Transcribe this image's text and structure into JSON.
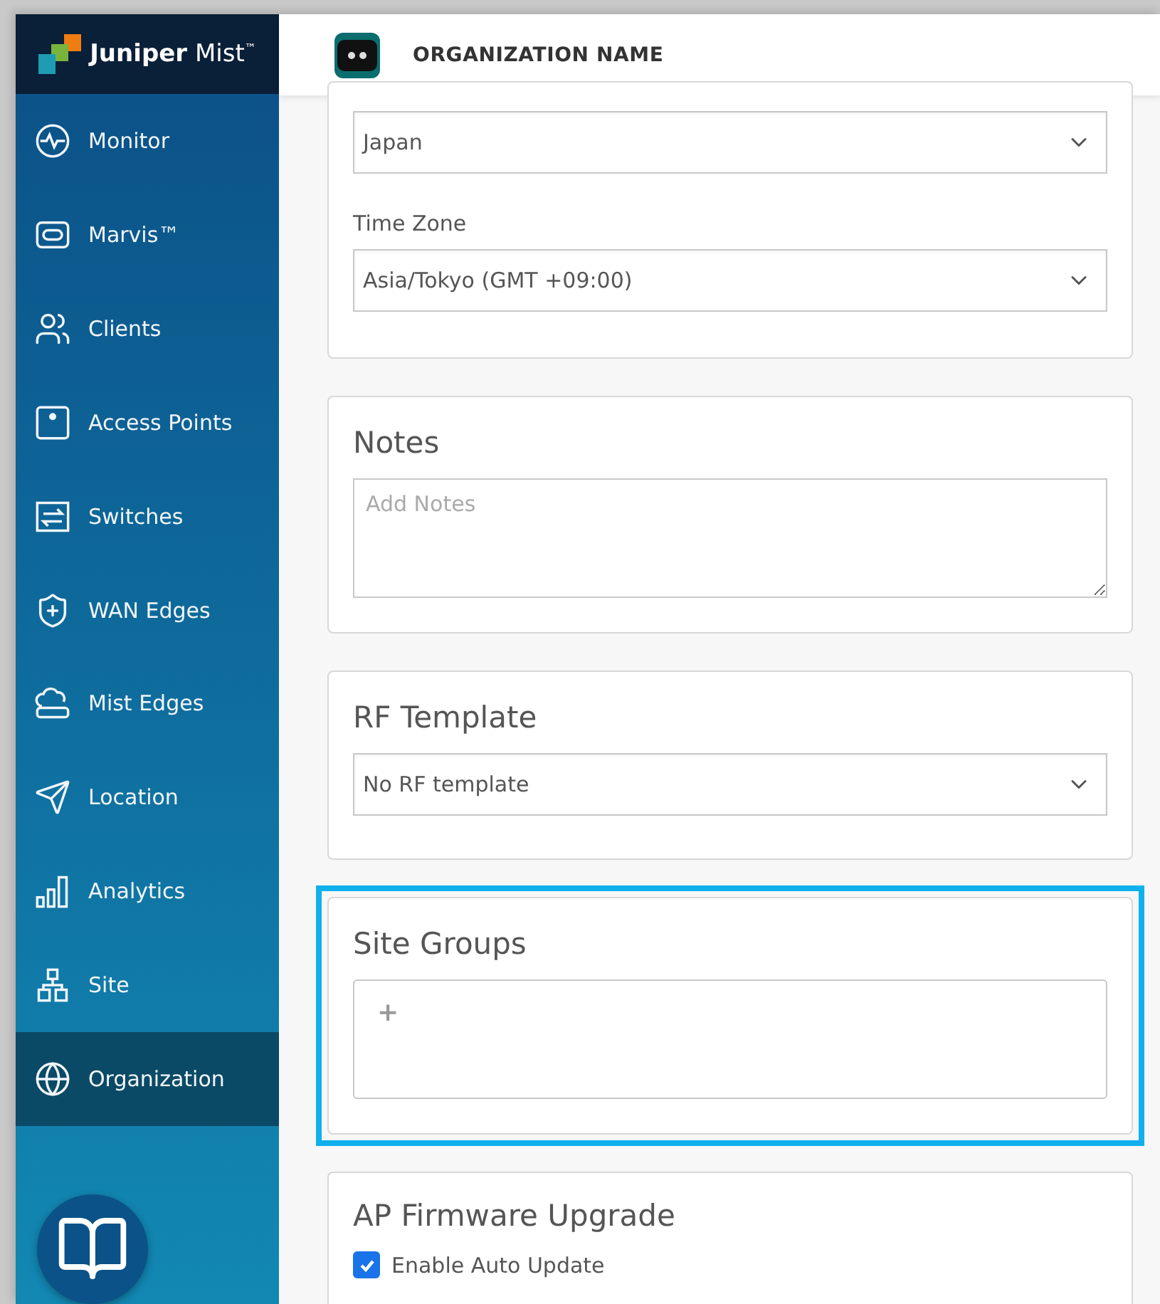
{
  "brand": {
    "name": "Juniper",
    "product": "Mist",
    "mark": "™"
  },
  "header": {
    "org_name": "ORGANIZATION NAME"
  },
  "sidebar": {
    "items": [
      {
        "label": "Monitor",
        "selected": false
      },
      {
        "label": "Marvis™",
        "selected": false
      },
      {
        "label": "Clients",
        "selected": false
      },
      {
        "label": "Access Points",
        "selected": false
      },
      {
        "label": "Switches",
        "selected": false
      },
      {
        "label": "WAN Edges",
        "selected": false
      },
      {
        "label": "Mist Edges",
        "selected": false
      },
      {
        "label": "Location",
        "selected": false
      },
      {
        "label": "Analytics",
        "selected": false
      },
      {
        "label": "Site",
        "selected": false
      },
      {
        "label": "Organization",
        "selected": true
      }
    ]
  },
  "location_card": {
    "country": "Japan",
    "time_zone_label": "Time Zone",
    "time_zone": "Asia/Tokyo (GMT +09:00)"
  },
  "notes_card": {
    "title": "Notes",
    "placeholder": "Add Notes"
  },
  "rf_card": {
    "title": "RF Template",
    "value": "No RF template"
  },
  "site_groups_card": {
    "title": "Site Groups",
    "add": "+",
    "highlighted": true
  },
  "firmware_card": {
    "title": "AP Firmware Upgrade",
    "checkbox": {
      "label": "Enable Auto Update",
      "checked": true
    }
  }
}
